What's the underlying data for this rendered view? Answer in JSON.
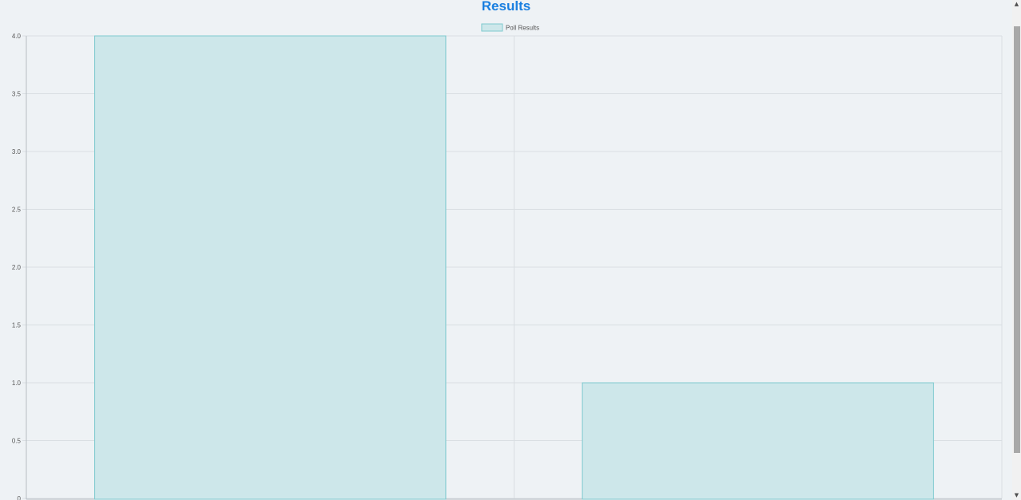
{
  "page": {
    "heading": "Results",
    "heading_color": "#1a7fe0"
  },
  "chart_data": {
    "type": "bar",
    "categories": [
      "",
      ""
    ],
    "series": [
      {
        "name": "Poll Results",
        "values": [
          4,
          1
        ]
      }
    ],
    "title": "",
    "xlabel": "",
    "ylabel": "",
    "ylim": [
      0,
      4
    ],
    "yticks": [
      "0",
      "0.5",
      "1.0",
      "1.5",
      "2.0",
      "2.5",
      "3.0",
      "3.5",
      "4.0"
    ],
    "grid": true,
    "legend": "top-center",
    "colors": {
      "bar_fill": "#cde7ea",
      "bar_stroke": "#7fcacf",
      "grid": "#d9dee2",
      "axis": "#b8bec4",
      "tick_text": "#555555"
    }
  },
  "scrollbar": {
    "up_glyph": "▲",
    "down_glyph": "▼"
  }
}
